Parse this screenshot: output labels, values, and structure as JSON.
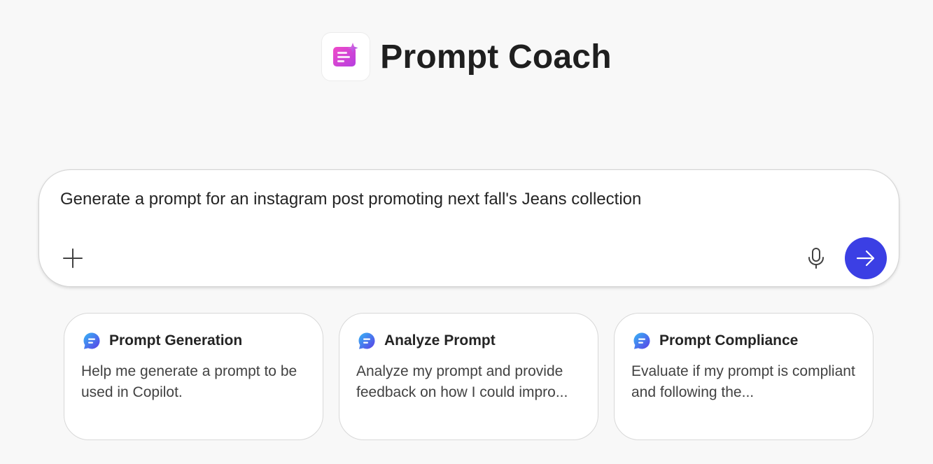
{
  "app": {
    "title": "Prompt Coach",
    "logo_icon": "prompt-coach-logo-icon"
  },
  "composer": {
    "value": "Generate a prompt for an instagram post promoting next fall's Jeans collection",
    "add_icon": "plus-icon",
    "mic_icon": "microphone-icon",
    "send_icon": "arrow-right-icon",
    "send_color": "#3b3fe4"
  },
  "cards": [
    {
      "icon": "chat-bubble-icon",
      "title": "Prompt Generation",
      "description": "Help me generate a prompt to be used in Copilot."
    },
    {
      "icon": "chat-bubble-icon",
      "title": "Analyze Prompt",
      "description": "Analyze my prompt and provide feedback on how I could impro..."
    },
    {
      "icon": "chat-bubble-icon",
      "title": "Prompt Compliance",
      "description": "Evaluate if my prompt is compliant and following the..."
    }
  ],
  "colors": {
    "background": "#f8f8f8",
    "accent": "#3b3fe4",
    "logo_gradient_start": "#e13fd0",
    "logo_gradient_end": "#a63ee8"
  }
}
